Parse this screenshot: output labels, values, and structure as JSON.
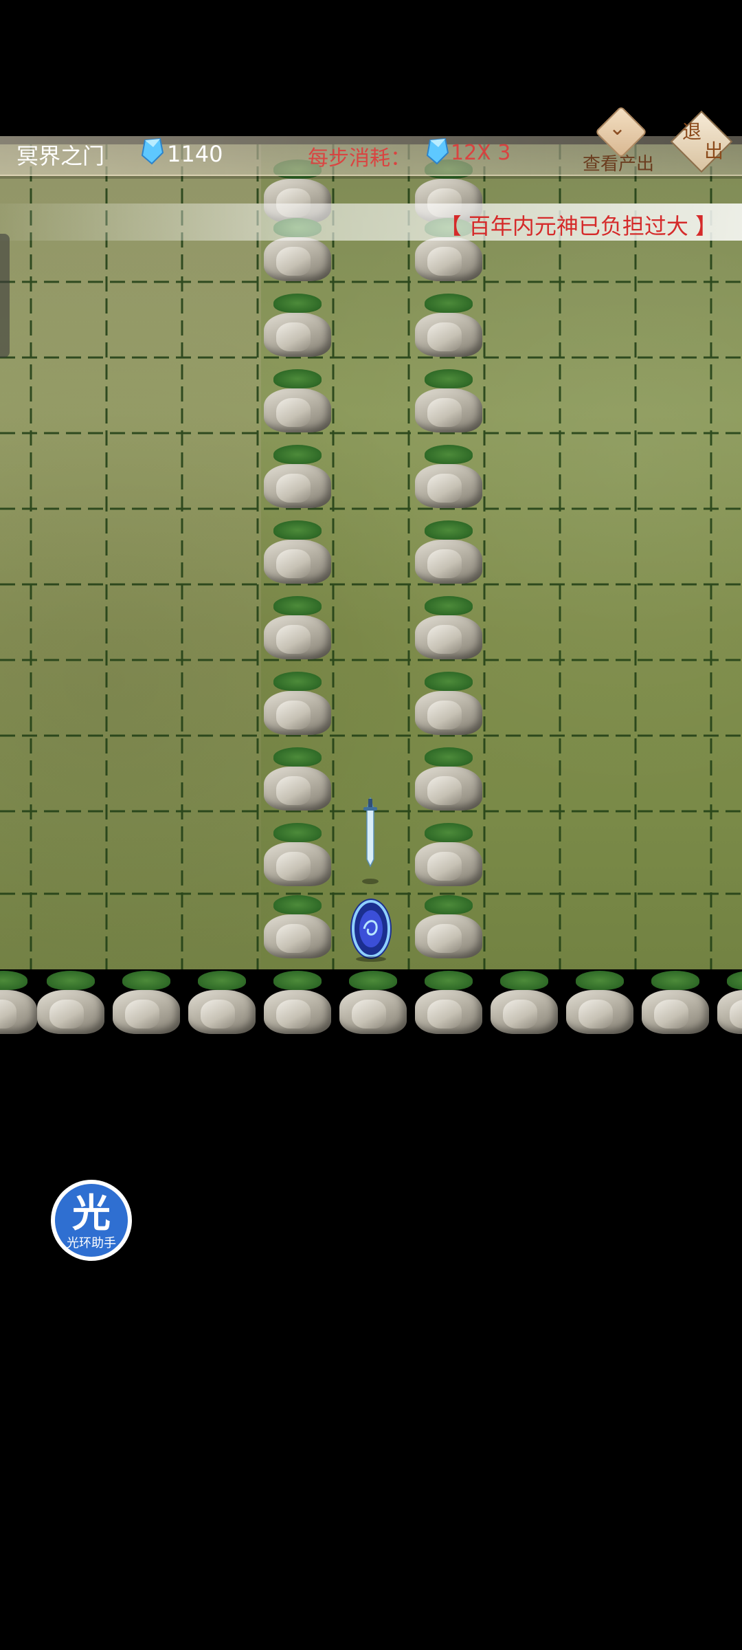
{
  "header": {
    "stage_name": "冥界之门",
    "resource_amount": "1140",
    "step_cost_label": "每步消耗：",
    "step_cost_value": "12X 3",
    "view_output_label": "查看产出",
    "exit_label_1": "退",
    "exit_label_2": "出"
  },
  "banner": {
    "message": "【 百年内元神已负担过大 】"
  },
  "assistant": {
    "big_char": "光",
    "label": "光环助手"
  },
  "icons": {
    "gem": "blue-crystal-icon",
    "chevron": "chevron-down-icon",
    "sword": "sword-icon",
    "portal": "portal-icon"
  },
  "colors": {
    "warning_text": "#d52a2a",
    "cost_text": "#e03b3b",
    "fab_blue": "#2f6fd1"
  }
}
